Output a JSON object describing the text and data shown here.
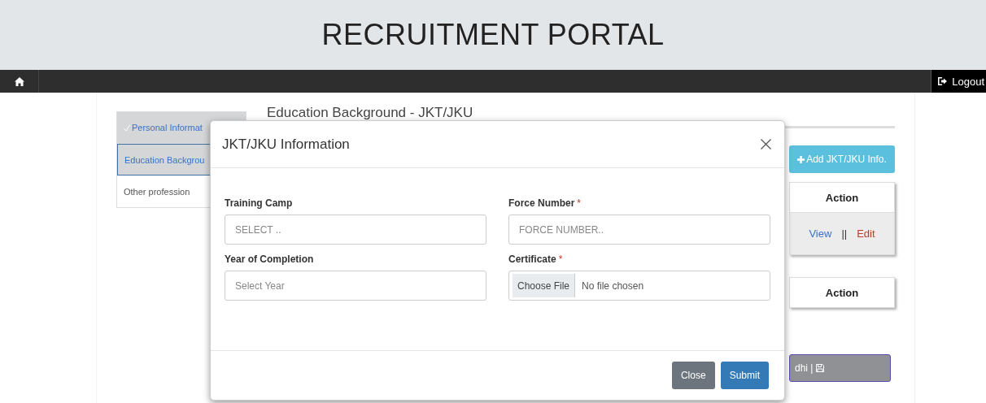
{
  "header": {
    "title": "RECRUITMENT PORTAL"
  },
  "navbar": {
    "logout": "Logout"
  },
  "sidebar": {
    "items": [
      {
        "label": "Personal Informat",
        "completed": true,
        "selected": false
      },
      {
        "label": "Education Backgrou",
        "completed": false,
        "selected": true
      },
      {
        "label": "Other profession",
        "completed": false,
        "selected": false
      }
    ]
  },
  "section": {
    "heading": "Education Background - JKT/JKU",
    "add_button": "Add JKT/JKU Info.",
    "tables": [
      {
        "column": "Action",
        "rows": [
          {
            "view": "View",
            "separator": "||",
            "edit": "Edit"
          }
        ]
      },
      {
        "column": "Action"
      }
    ],
    "save_button": "dhi |"
  },
  "modal": {
    "title": "JKT/JKU Information",
    "fields": [
      {
        "kind": "select",
        "label": "Training Camp",
        "placeholder": "SELECT .."
      },
      {
        "kind": "text",
        "label": "Force Number",
        "required_mark": "*",
        "placeholder": "FORCE NUMBER.."
      },
      {
        "kind": "select",
        "label": "Year of Completion",
        "placeholder": "Select Year"
      },
      {
        "kind": "file",
        "label": "Certificate",
        "required_mark": "*",
        "button": "Choose File",
        "value": "No file chosen"
      }
    ],
    "buttons": [
      {
        "kind": "secondary",
        "label": "Close"
      },
      {
        "kind": "primary",
        "label": "Submit"
      }
    ]
  }
}
